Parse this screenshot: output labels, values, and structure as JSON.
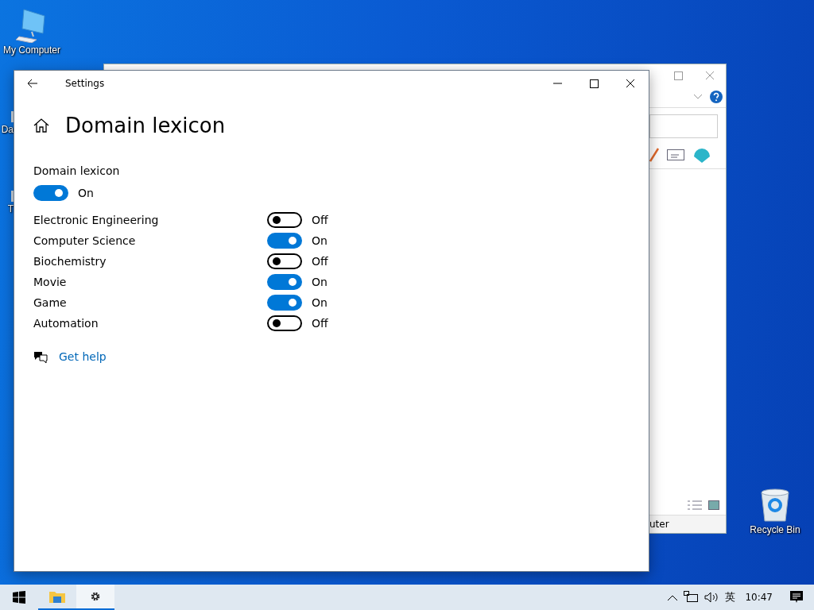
{
  "desktop_icons": [
    {
      "label": "My Computer",
      "kind": "computer"
    },
    {
      "label": "Da",
      "kind": "partial"
    },
    {
      "label": "T",
      "kind": "partial"
    },
    {
      "label": "Recycle Bin",
      "kind": "recycle"
    }
  ],
  "background_window": {
    "status_text": "uter"
  },
  "settings": {
    "title": "Settings",
    "heading": "Domain lexicon",
    "master": {
      "label": "Domain lexicon",
      "on": true,
      "state_text": "On"
    },
    "domains": [
      {
        "label": "Electronic Engineering",
        "on": false,
        "state_text": "Off"
      },
      {
        "label": "Computer Science",
        "on": true,
        "state_text": "On"
      },
      {
        "label": "Biochemistry",
        "on": false,
        "state_text": "Off"
      },
      {
        "label": "Movie",
        "on": true,
        "state_text": "On"
      },
      {
        "label": "Game",
        "on": true,
        "state_text": "On"
      },
      {
        "label": "Automation",
        "on": false,
        "state_text": "Off"
      }
    ],
    "help_link": "Get help"
  },
  "taskbar": {
    "apps": [
      {
        "kind": "folder",
        "selected": false
      },
      {
        "kind": "gear",
        "selected": true
      }
    ],
    "ime": "英",
    "clock": "10:47"
  }
}
